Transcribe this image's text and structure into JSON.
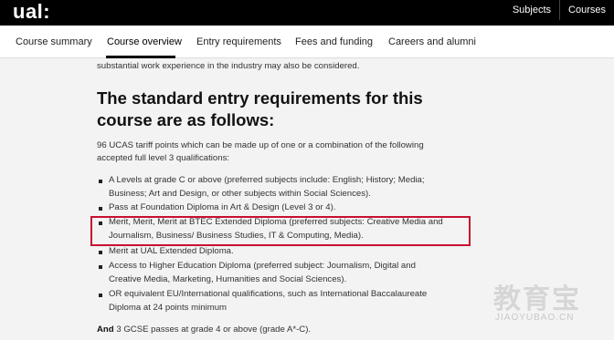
{
  "header": {
    "logo": "ual:",
    "nav": [
      "Subjects",
      "Courses"
    ]
  },
  "tabs": [
    {
      "label": "Course summary",
      "active": false
    },
    {
      "label": "Course overview",
      "active": true
    },
    {
      "label": "Entry requirements",
      "active": false
    },
    {
      "label": "Fees and funding",
      "active": false
    },
    {
      "label": "Careers and alumni",
      "active": false
    }
  ],
  "content": {
    "intro_partial": "substantial work experience in the industry may also be considered.",
    "heading_line1": "The standard entry requirements for this",
    "heading_line2": "course are as follows:",
    "para_line1": "96 UCAS tariff points which can be made up of one or a combination of the following",
    "para_line2": "accepted full level 3 qualifications:",
    "bullets": [
      {
        "lines": [
          "A Levels at grade C or above (preferred subjects include: English; History; Media;",
          "Business; Art and Design, or other subjects within Social Sciences)."
        ]
      },
      {
        "lines": [
          "Pass at Foundation Diploma in Art & Design (Level 3 or 4)."
        ]
      },
      {
        "lines": [
          "Merit, Merit, Merit at BTEC Extended Diploma (preferred subjects: Creative Media and",
          "Journalism, Business/ Business Studies, IT & Computing, Media)."
        ]
      },
      {
        "lines": [
          "Merit at UAL Extended Diploma."
        ]
      },
      {
        "lines": [
          "Access to Higher Education Diploma (preferred subject: Journalism, Digital and",
          "Creative Media, Marketing, Humanities and Social Sciences)."
        ]
      },
      {
        "lines": [
          "OR equivalent EU/International qualifications, such as International Baccalaureate",
          "Diploma at 24 points minimum"
        ]
      }
    ],
    "gcse_bold": "And",
    "gcse_rest": " 3 GCSE passes at grade 4 or above (grade A*-C)."
  },
  "watermark": {
    "glyphs": "教育宝",
    "url": "JIAOYUBAO.CN"
  },
  "colors": {
    "highlight_border": "#c8102e",
    "topbar": "#000000"
  }
}
